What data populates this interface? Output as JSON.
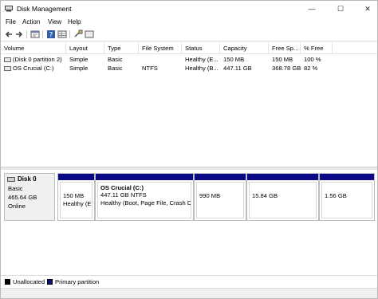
{
  "window": {
    "title": "Disk Management",
    "controls": {
      "minimize": "—",
      "maximize": "☐",
      "close": "✕"
    }
  },
  "menu": {
    "file": "File",
    "action": "Action",
    "view": "View",
    "help": "Help"
  },
  "toolbar": {
    "icons": [
      "back-arrow-icon",
      "forward-arrow-icon",
      "properties-icon",
      "help-icon",
      "rescan-disks-icon",
      "console-icon"
    ]
  },
  "list": {
    "columns": [
      "Volume",
      "Layout",
      "Type",
      "File System",
      "Status",
      "Capacity",
      "Free Sp...",
      "% Free"
    ],
    "rows": [
      {
        "volume": "(Disk 0 partition 2)",
        "layout": "Simple",
        "type": "Basic",
        "fs": "",
        "status": "Healthy (E...",
        "capacity": "150 MB",
        "free": "150 MB",
        "pct": "100 %"
      },
      {
        "volume": "OS Crucial (C:)",
        "layout": "Simple",
        "type": "Basic",
        "fs": "NTFS",
        "status": "Healthy (B...",
        "capacity": "447.11 GB",
        "free": "368.78 GB",
        "pct": "82 %"
      }
    ]
  },
  "disk": {
    "name": "Disk 0",
    "type": "Basic",
    "size": "465.64 GB",
    "state": "Online",
    "partitions": [
      {
        "title": "",
        "size": "150 MB",
        "status": "Healthy (EF"
      },
      {
        "title": "OS Crucial  (C:)",
        "size": "447.11 GB NTFS",
        "status": "Healthy (Boot, Page File, Crash Du"
      },
      {
        "title": "",
        "size": "990 MB",
        "status": ""
      },
      {
        "title": "",
        "size": "15.84 GB",
        "status": ""
      },
      {
        "title": "",
        "size": "1.56 GB",
        "status": ""
      }
    ]
  },
  "legend": {
    "unallocated": "Unallocated",
    "primary": "Primary partition",
    "colors": {
      "unallocated": "#000000",
      "primary": "#0a0a88"
    }
  }
}
